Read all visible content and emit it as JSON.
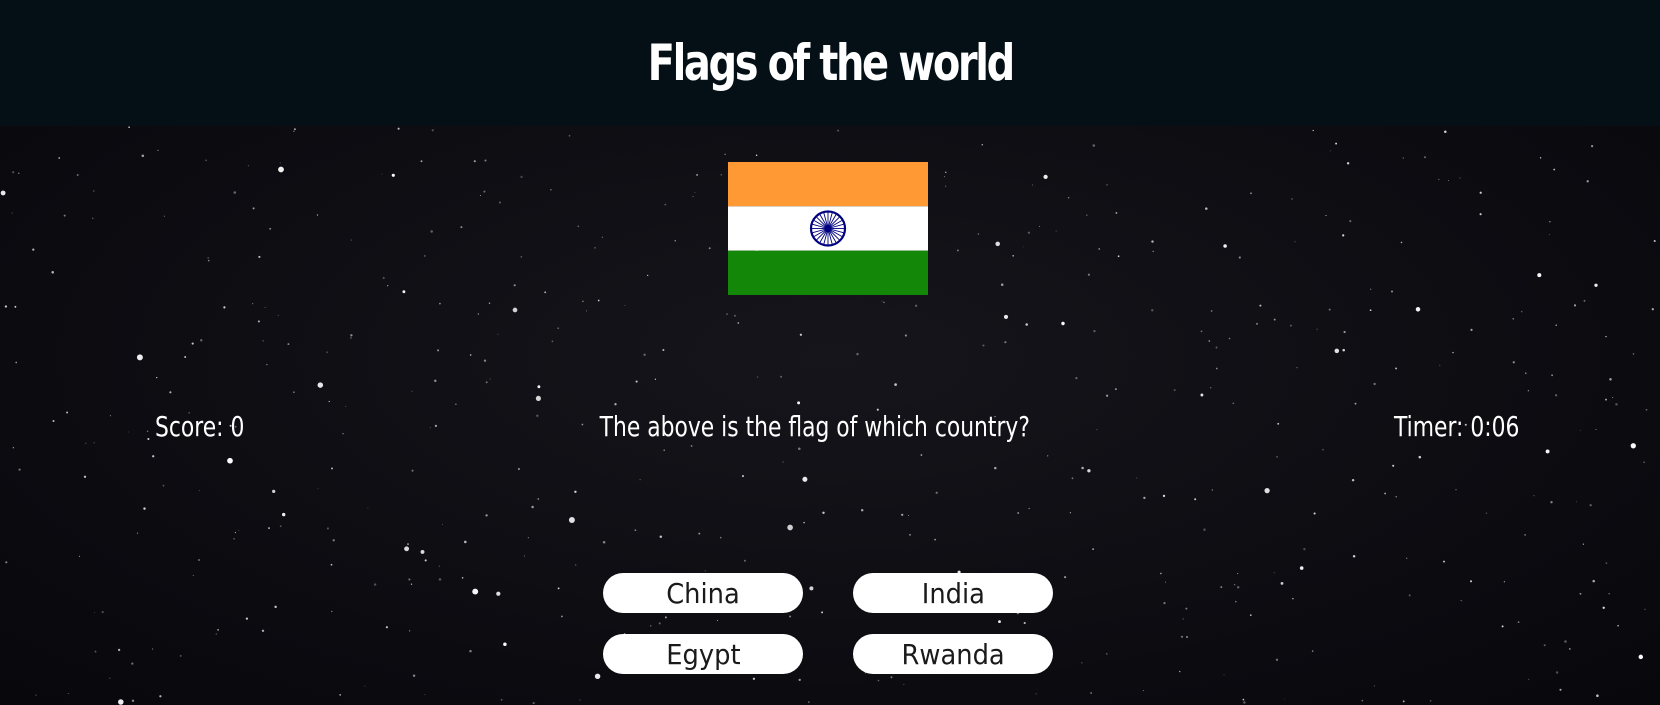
{
  "page": {
    "title": "Flags of the world"
  },
  "game": {
    "flag_icon": "india-flag",
    "score_text": "Score: 0",
    "question_text": "The above is the flag of which country?",
    "timer_text": "Timer: 0:06"
  },
  "answers": [
    {
      "label": "China"
    },
    {
      "label": "India"
    },
    {
      "label": "Egypt"
    },
    {
      "label": "Rwanda"
    }
  ],
  "colors": {
    "header_background": "#040f16",
    "flag_saffron": "#ff9933",
    "flag_white": "#ffffff",
    "flag_green": "#138808",
    "flag_chakra": "#000080",
    "answer_button": "#ffffff"
  }
}
